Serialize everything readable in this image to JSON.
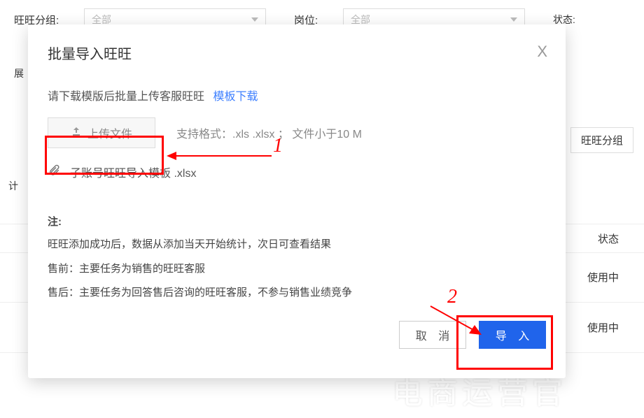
{
  "bg": {
    "group_label": "旺旺分组:",
    "group_value": "全部",
    "position_label": "岗位:",
    "position_value": "全部",
    "status_label": "状态:",
    "expand": "展",
    "group_btn": "旺旺分组",
    "count_label": "计",
    "table_status_header": "状态",
    "row_status_1": "使用中",
    "row_status_2": "使用中"
  },
  "modal": {
    "title": "批量导入旺旺",
    "close_icon": "X",
    "instruction": "请下载模版后批量上传客服旺旺",
    "template_link": "模板下载",
    "upload_btn": "上传文件",
    "format_text": "支持格式：.xls .xlsx ； 文件小于10 M",
    "file_name": "子账号旺旺导入模板 .xlsx",
    "note_title": "注:",
    "note_line1": "旺旺添加成功后，数据从添加当天开始统计，次日可查看结果",
    "note_line2": "售前：主要任务为销售的旺旺客服",
    "note_line3": "售后：主要任务为回答售后咨询的旺旺客服，不参与销售业绩竞争",
    "cancel": "取 消",
    "confirm": "导 入"
  },
  "annotations": {
    "one": "1",
    "two": "2"
  },
  "watermark": "电商运营官"
}
